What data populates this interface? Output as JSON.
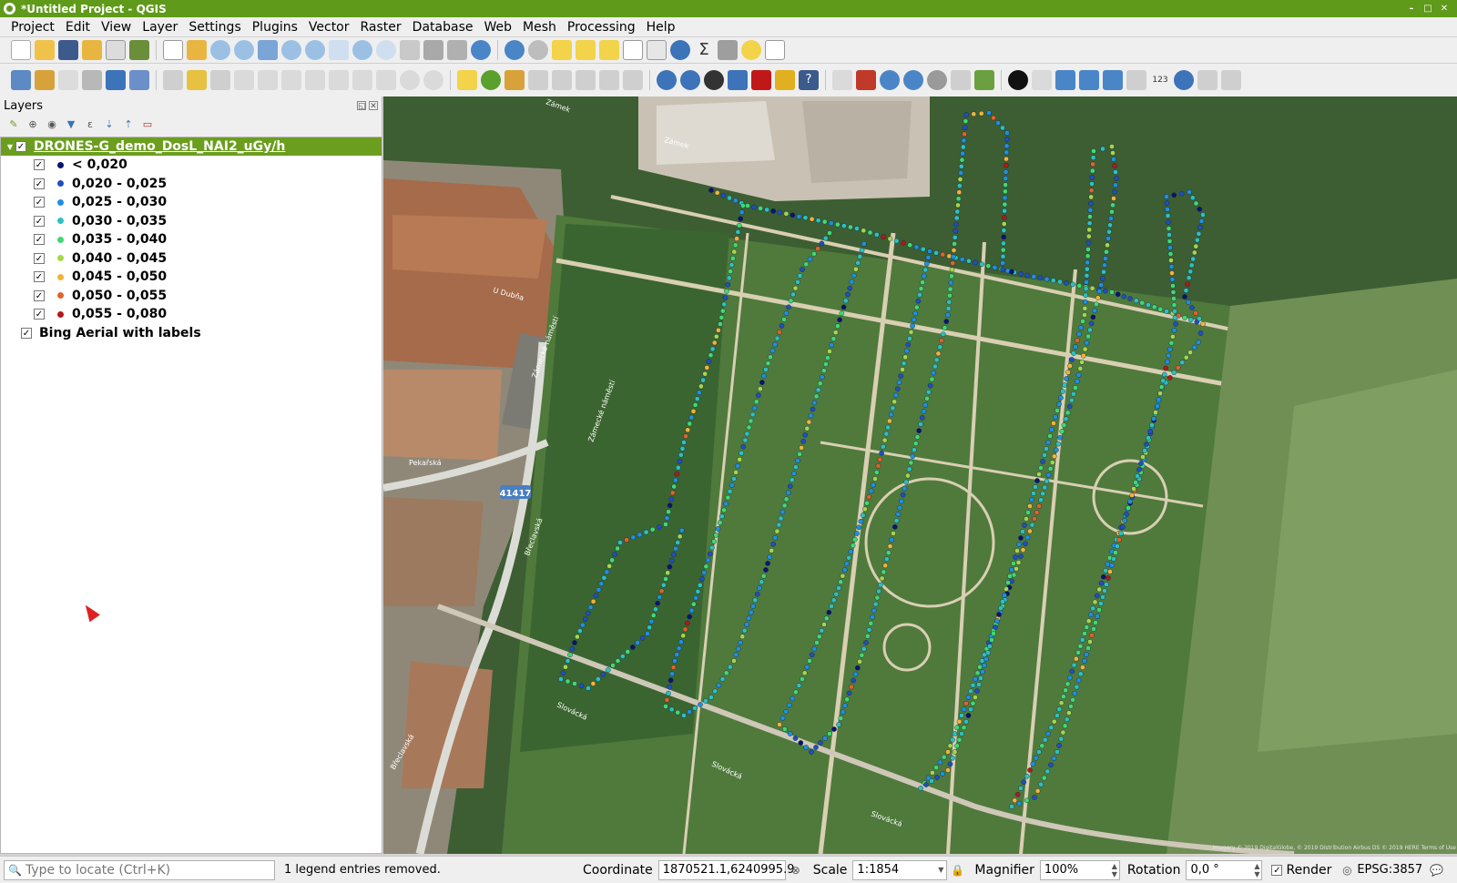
{
  "window": {
    "title": "*Untitled Project - QGIS",
    "buttons": [
      "–",
      "□",
      "✕"
    ]
  },
  "menu": [
    "Project",
    "Edit",
    "View",
    "Layer",
    "Settings",
    "Plugins",
    "Vector",
    "Raster",
    "Database",
    "Web",
    "Mesh",
    "Processing",
    "Help"
  ],
  "layers_panel": {
    "title": "Layers",
    "group_layer": "DRONES-G_demo_DosL_NAI2_uGy/h",
    "legend": [
      {
        "label": "< 0,020",
        "color": "#0a1470"
      },
      {
        "label": "0,020 - 0,025",
        "color": "#1f4fc0"
      },
      {
        "label": "0,025 - 0,030",
        "color": "#1f90e0"
      },
      {
        "label": "0,030 - 0,035",
        "color": "#2ec0c0"
      },
      {
        "label": "0,035 - 0,040",
        "color": "#42d873"
      },
      {
        "label": "0,040 - 0,045",
        "color": "#a6d64a"
      },
      {
        "label": "0,045 - 0,050",
        "color": "#f2b23a"
      },
      {
        "label": "0,050 - 0,055",
        "color": "#e0632a"
      },
      {
        "label": "0,055 - 0,080",
        "color": "#b41818"
      }
    ],
    "base_layer": "Bing Aerial with labels"
  },
  "map": {
    "labels": [
      "41417",
      "Zámek",
      "Zámek",
      "Slovácká",
      "Slovácká",
      "Slovácká",
      "Břeclavská",
      "Břeclavská",
      "Pekařská",
      "Zámecké náměstí",
      "Zámecké náměstí",
      "U Dubňa"
    ],
    "attribution": "Imagery © 2019 DigitalGlobe, © 2019 Distribution Airbus DS © 2019 HERE Terms of Use"
  },
  "statusbar": {
    "locator_placeholder": "Type to locate (Ctrl+K)",
    "message": "1 legend entries removed.",
    "coordinate_label": "Coordinate",
    "coordinate_value": "1870521.1,6240995.9",
    "scale_label": "Scale",
    "scale_value": "1:1854",
    "magnifier_label": "Magnifier",
    "magnifier_value": "100%",
    "rotation_label": "Rotation",
    "rotation_value": "0,0 °",
    "render_label": "Render",
    "crs": "EPSG:3857"
  }
}
